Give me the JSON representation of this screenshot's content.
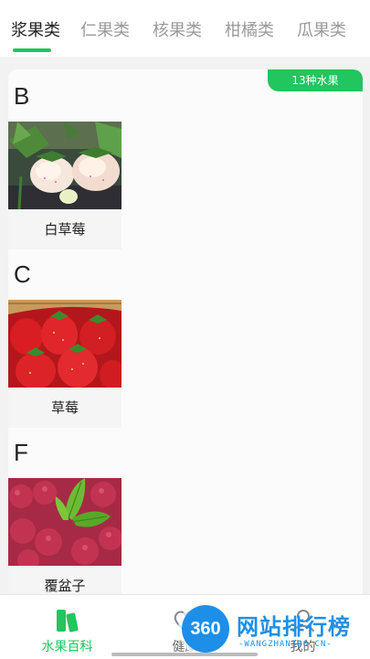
{
  "tabs": [
    {
      "label": "浆果类",
      "active": true
    },
    {
      "label": "仁果类",
      "active": false
    },
    {
      "label": "核果类",
      "active": false
    },
    {
      "label": "柑橘类",
      "active": false
    },
    {
      "label": "瓜果类",
      "active": false
    }
  ],
  "colors": {
    "accent": "#22c55e",
    "watermark": "#1d8fe8"
  },
  "content": {
    "count_badge": "13种水果",
    "sections": [
      {
        "letter": "B",
        "fruits": [
          {
            "name": "白草莓",
            "image": "white-strawberry-photo"
          }
        ]
      },
      {
        "letter": "C",
        "fruits": [
          {
            "name": "草莓",
            "image": "strawberry-photo"
          }
        ]
      },
      {
        "letter": "F",
        "fruits": [
          {
            "name": "覆盆子",
            "image": "raspberry-photo"
          }
        ]
      }
    ]
  },
  "bottom_nav": [
    {
      "label": "水果百科",
      "icon": "book-icon",
      "active": true
    },
    {
      "label": "健康",
      "icon": "heart-icon",
      "active": false
    },
    {
      "label": "我的",
      "icon": "user-icon",
      "active": false
    }
  ],
  "watermark": {
    "badge": "360",
    "title": "网站排行榜",
    "subtitle": "-WANGZHAN360.CN-"
  }
}
